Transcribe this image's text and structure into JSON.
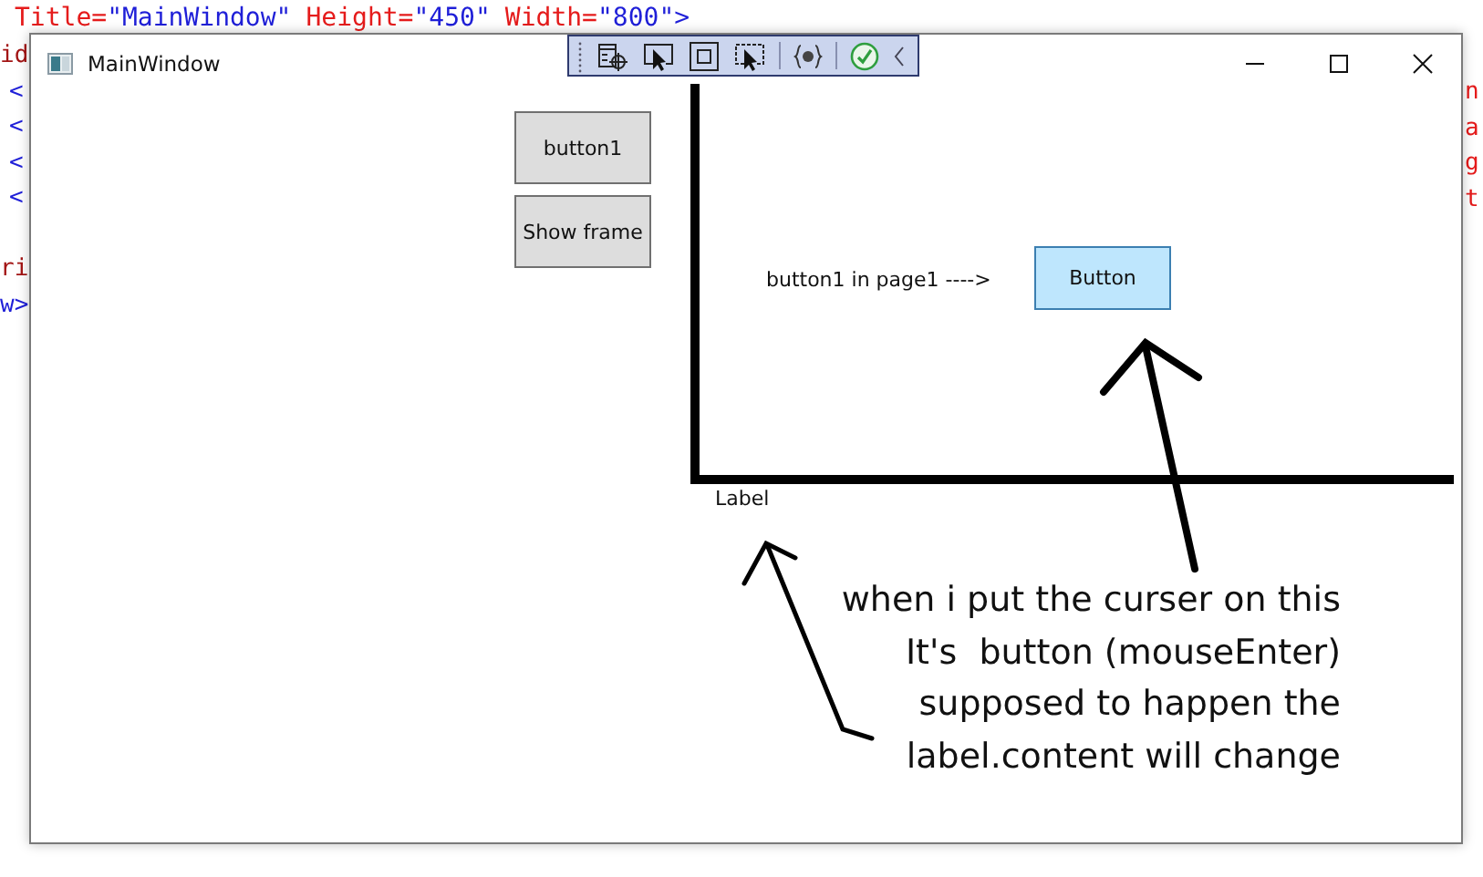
{
  "editor": {
    "top_line": [
      {
        "text": "Title=",
        "kind": "attr"
      },
      {
        "text": "\"MainWindow\"",
        "kind": "value"
      },
      {
        "text": "Height=",
        "kind": "attr"
      },
      {
        "text": "\"450\"",
        "kind": "value"
      },
      {
        "text": "Width=",
        "kind": "attr"
      },
      {
        "text": "\"800\">",
        "kind": "value"
      }
    ],
    "left_fragments": [
      {
        "text": "id",
        "kind": "tag"
      },
      {
        "text": "<",
        "kind": "punct"
      },
      {
        "text": "<",
        "kind": "punct"
      },
      {
        "text": "<",
        "kind": "punct"
      },
      {
        "text": "<",
        "kind": "punct"
      },
      {
        "text": "ri",
        "kind": "tag"
      },
      {
        "text": "w>",
        "kind": "punct"
      }
    ],
    "right_fragments": [
      {
        "text": "n",
        "kind": "attr"
      },
      {
        "text": "a",
        "kind": "attr"
      },
      {
        "text": "g",
        "kind": "attr"
      },
      {
        "text": "t",
        "kind": "attr"
      }
    ]
  },
  "window": {
    "title": "MainWindow",
    "buttons": [
      "button1",
      "Show frame"
    ]
  },
  "page": {
    "caption": "button1 in page1 ---->",
    "button": "Button",
    "label": "Label"
  },
  "annotation": {
    "lines": [
      "when i put the curser on this",
      "It's  button (mouseEnter)",
      "supposed to happen the",
      "label.content will change"
    ]
  }
}
